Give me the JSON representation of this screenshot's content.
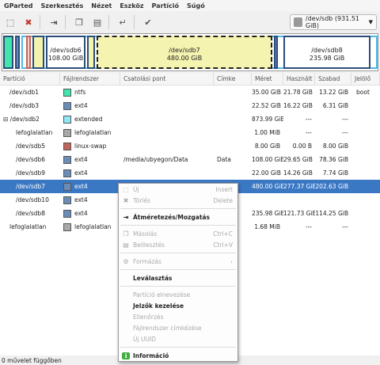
{
  "menu": [
    "GParted",
    "Szerkesztés",
    "Nézet",
    "Eszköz",
    "Partíció",
    "Súgó"
  ],
  "device": "/dev/sdb   (931.51 GiB)",
  "diskbar": {
    "segments": [
      {
        "name": "/dev/sdb6",
        "size": "108.00 GiB"
      },
      {
        "name": "/dev/sdb7",
        "size": "480.00 GiB"
      },
      {
        "name": "/dev/sdb8",
        "size": "235.98 GiB"
      }
    ]
  },
  "columns": [
    "Partíció",
    "Fájlrendszer",
    "Csatolási pont",
    "Címke",
    "Méret",
    "Használt",
    "Szabad",
    "Jelölő"
  ],
  "rows": [
    {
      "part": "/dev/sdb1",
      "fs": "ntfs",
      "color": "#42e5ac",
      "mount": "",
      "label": "",
      "size": "35.00 GiB",
      "used": "21.78 GiB",
      "free": "13.22 GiB",
      "flags": "boot"
    },
    {
      "part": "/dev/sdb3",
      "fs": "ext4",
      "color": "#6a8db8",
      "mount": "",
      "label": "",
      "size": "22.52 GiB",
      "used": "16.22 GiB",
      "free": "6.31 GiB",
      "flags": ""
    },
    {
      "part": "/dev/sdb2",
      "fs": "extended",
      "color": "#8ee8f6",
      "mount": "",
      "label": "",
      "size": "873.99 GiB",
      "used": "---",
      "free": "---",
      "flags": ""
    },
    {
      "part": "lefoglalatlan",
      "fs": "lefoglalatlan",
      "color": "#a8a8a8",
      "mount": "",
      "label": "",
      "size": "1.00 MiB",
      "used": "---",
      "free": "---",
      "flags": ""
    },
    {
      "part": "/dev/sdb5",
      "fs": "linux-swap",
      "color": "#c1665a",
      "mount": "",
      "label": "",
      "size": "8.00 GiB",
      "used": "0.00 B",
      "free": "8.00 GiB",
      "flags": ""
    },
    {
      "part": "/dev/sdb6",
      "fs": "ext4",
      "color": "#6a8db8",
      "mount": "/media/ubyegon/Data",
      "label": "Data",
      "size": "108.00 GiB",
      "used": "29.65 GiB",
      "free": "78.36 GiB",
      "flags": ""
    },
    {
      "part": "/dev/sdb9",
      "fs": "ext4",
      "color": "#6a8db8",
      "mount": "",
      "label": "",
      "size": "22.00 GiB",
      "used": "14.26 GiB",
      "free": "7.74 GiB",
      "flags": ""
    },
    {
      "part": "/dev/sdb7",
      "fs": "ext4",
      "color": "#6a8db8",
      "mount": "",
      "label": "",
      "size": "480.00 GiB",
      "used": "277.37 GiB",
      "free": "202.63 GiB",
      "flags": ""
    },
    {
      "part": "/dev/sdb10",
      "fs": "ext4",
      "color": "#6a8db8",
      "mount": "",
      "label": "",
      "size": "",
      "used": "",
      "free": "",
      "flags": ""
    },
    {
      "part": "/dev/sdb8",
      "fs": "ext4",
      "color": "#6a8db8",
      "mount": "",
      "label": "",
      "size": "235.98 GiB",
      "used": "121.73 GiB",
      "free": "114.25 GiB",
      "flags": ""
    },
    {
      "part": "lefoglalatlan",
      "fs": "lefoglalatlan",
      "color": "#a8a8a8",
      "mount": "",
      "label": "",
      "size": "1.68 MiB",
      "used": "---",
      "free": "---",
      "flags": ""
    }
  ],
  "status": "0 művelet függőben",
  "context_menu": [
    {
      "label": "Új",
      "accel": "Insert",
      "disabled": true,
      "icon": "new-icon"
    },
    {
      "label": "Törlés",
      "accel": "Delete",
      "disabled": true,
      "icon": "delete-icon"
    },
    {
      "sep": true
    },
    {
      "label": "Átméretezés/Mozgatás",
      "accel": "",
      "disabled": false,
      "bold": true,
      "icon": "resize-icon"
    },
    {
      "sep": true
    },
    {
      "label": "Másolás",
      "accel": "Ctrl+C",
      "disabled": true,
      "icon": "copy-icon"
    },
    {
      "label": "Beillesztés",
      "accel": "Ctrl+V",
      "disabled": true,
      "icon": "paste-icon"
    },
    {
      "sep": true
    },
    {
      "label": "Formázás",
      "accel": "›",
      "disabled": true,
      "icon": "format-icon"
    },
    {
      "sep": true
    },
    {
      "label": "Leválasztás",
      "accel": "",
      "disabled": false,
      "bold": true,
      "icon": ""
    },
    {
      "sep": true
    },
    {
      "label": "Partíció elnevezése",
      "accel": "",
      "disabled": true,
      "icon": ""
    },
    {
      "label": "Jelzők kezelése",
      "accel": "",
      "disabled": false,
      "bold": true,
      "icon": ""
    },
    {
      "label": "Ellenőrzés",
      "accel": "",
      "disabled": true,
      "icon": ""
    },
    {
      "label": "Fájlrendszer címkézése",
      "accel": "",
      "disabled": true,
      "icon": ""
    },
    {
      "label": "Új UUID",
      "accel": "",
      "disabled": true,
      "icon": ""
    },
    {
      "sep": true
    },
    {
      "label": "Információ",
      "accel": "",
      "disabled": false,
      "bold": true,
      "icon": "info-icon"
    }
  ]
}
